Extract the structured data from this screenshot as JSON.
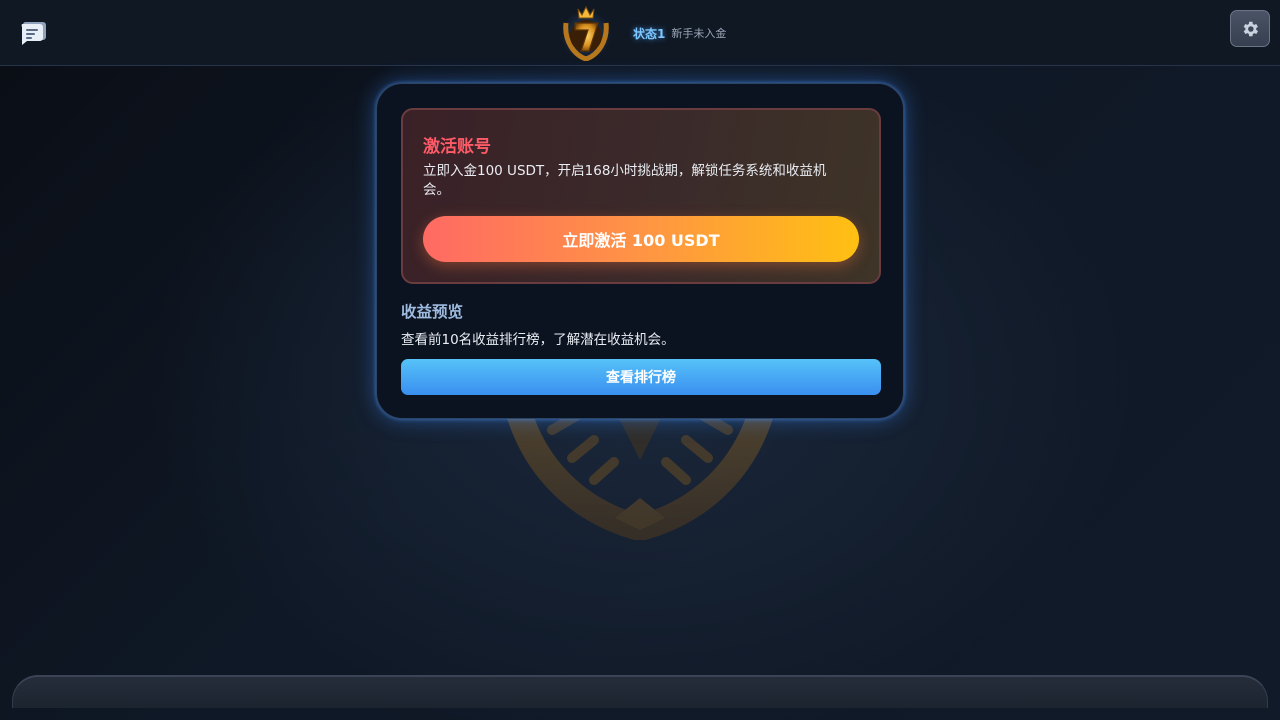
{
  "header": {
    "chat_icon": "chat-bubble-icon",
    "logo_icon": "lucky-seven-crown-emblem",
    "status_name": "状态1",
    "status_desc": "新手未入金",
    "settings_icon": "gear-icon"
  },
  "activate": {
    "title": "激活账号",
    "description": "立即入金100 USDT，开启168小时挑战期，解锁任务系统和收益机会。",
    "button_label": "立即激活 100 USDT"
  },
  "preview": {
    "title": "收益预览",
    "description": "查看前10名收益排行榜，了解潜在收益机会。",
    "button_label": "查看排行榜"
  },
  "colors": {
    "accent_red": "#ff5a67",
    "accent_blue": "#3a8ff0",
    "gradient_start": "#ff6a63",
    "gradient_end": "#ffc012",
    "status_glow": "#7cc7ff"
  }
}
